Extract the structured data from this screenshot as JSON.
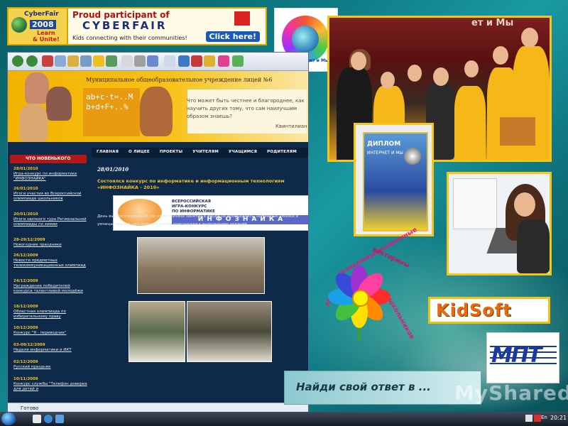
{
  "cyberfair": {
    "logo_top": "CyberFair",
    "logo_year": "2008",
    "logo_sub1": "Learn",
    "logo_sub2": "& Unite!",
    "headline": "Proud participant of",
    "brand": "CYBERFAIR",
    "tagline": "Kids connecting with their communities!",
    "cta": "Click here!"
  },
  "festival": {
    "label": "«Интернет и Мы»"
  },
  "browser": {
    "status": "Готово",
    "site": {
      "title": "Муниципальное общеобразовательное учреждение лицей №6",
      "board_text": "ab+c·t=..M\nb+d+F+..%",
      "quote": "Что может быть честнее и благороднее, как научить других тому, что сам наилучшим образом знаешь?",
      "quote_author": "Квинтилиан",
      "nav": [
        "ГЛАВНАЯ",
        "О ЛИЦЕЕ",
        "ПРОЕКТЫ",
        "УЧИТЕЛЯМ",
        "УЧАЩИМСЯ",
        "РОДИТЕЛЯМ"
      ],
      "news_heading": "ЧТО НОВЕНЬКОГО",
      "news": [
        {
          "date": "28/01/2010",
          "text": "Игра-конкурс по информатике \"ИНФОЗНАЙКА\""
        },
        {
          "date": "26/01/2010",
          "text": "Итоги участия во Всероссийской олимпиаде школьников"
        },
        {
          "date": "20/01/2010",
          "text": "Итоги заочного тура Региональной олимпиады по химии"
        },
        {
          "date": "28-29/12/2009",
          "text": "Новогодние праздники"
        },
        {
          "date": "26/12/2009",
          "text": "Новости предметных телекоммуникационных олимпиад"
        },
        {
          "date": "24/12/2009",
          "text": "Награждение победителей конкурса талантливой молодёжи"
        },
        {
          "date": "18/12/2009",
          "text": "Областная олимпиада по избирательному праву"
        },
        {
          "date": "10/12/2009",
          "text": "Конкурс \"Я - переводчик\""
        },
        {
          "date": "03-09/12/2009",
          "text": "Неделя информатики и ИКТ"
        },
        {
          "date": "02/12/2009",
          "text": "Русский праздник"
        },
        {
          "date": "10/11/2009",
          "text": "Конкурс службы \"Телефон доверия для детей и"
        }
      ],
      "article_date": "28/01/2010",
      "article_title": "Состоялся конкурс по информатике и информационным технологиям «ИНФОЗНАЙКА - 2010»",
      "banner_caption": "ВСЕРОССИЙСКАЯ\nИГРА-КОНКУРС\nПО ИНФОРМАТИКЕ",
      "banner_big": "ИНФОЗНАЙКА",
      "article_text": "День выдался морозный, по этой причине занятия в лицее не проводились, но смелые умники и умницы ровно в назначенное время приступили к выполнению заданий."
    }
  },
  "photo_top": {
    "wall_text": "ет и Мы"
  },
  "diploma": {
    "title": "ДИПЛОМ",
    "subtitle": "ИНТЕРНЕТ И МЫ"
  },
  "flower": {
    "arc1": "телекоммуникационные",
    "arc2": "викторины",
    "arc3": "для",
    "arc4": "школьников",
    "petals": [
      "#ff2a2a",
      "#ff8a00",
      "#ffe000",
      "#44c040",
      "#1aa0e8",
      "#3a4ad8",
      "#a030d0",
      "#ff40a0"
    ]
  },
  "kidsoft": {
    "label": "KidSoft"
  },
  "mpt": {
    "label": "МПТ"
  },
  "find": {
    "label": "Найди свой ответ в ..."
  },
  "watermark": {
    "label": "MyShared"
  },
  "taskbar": {
    "lang": "En",
    "clock": "20:21"
  }
}
